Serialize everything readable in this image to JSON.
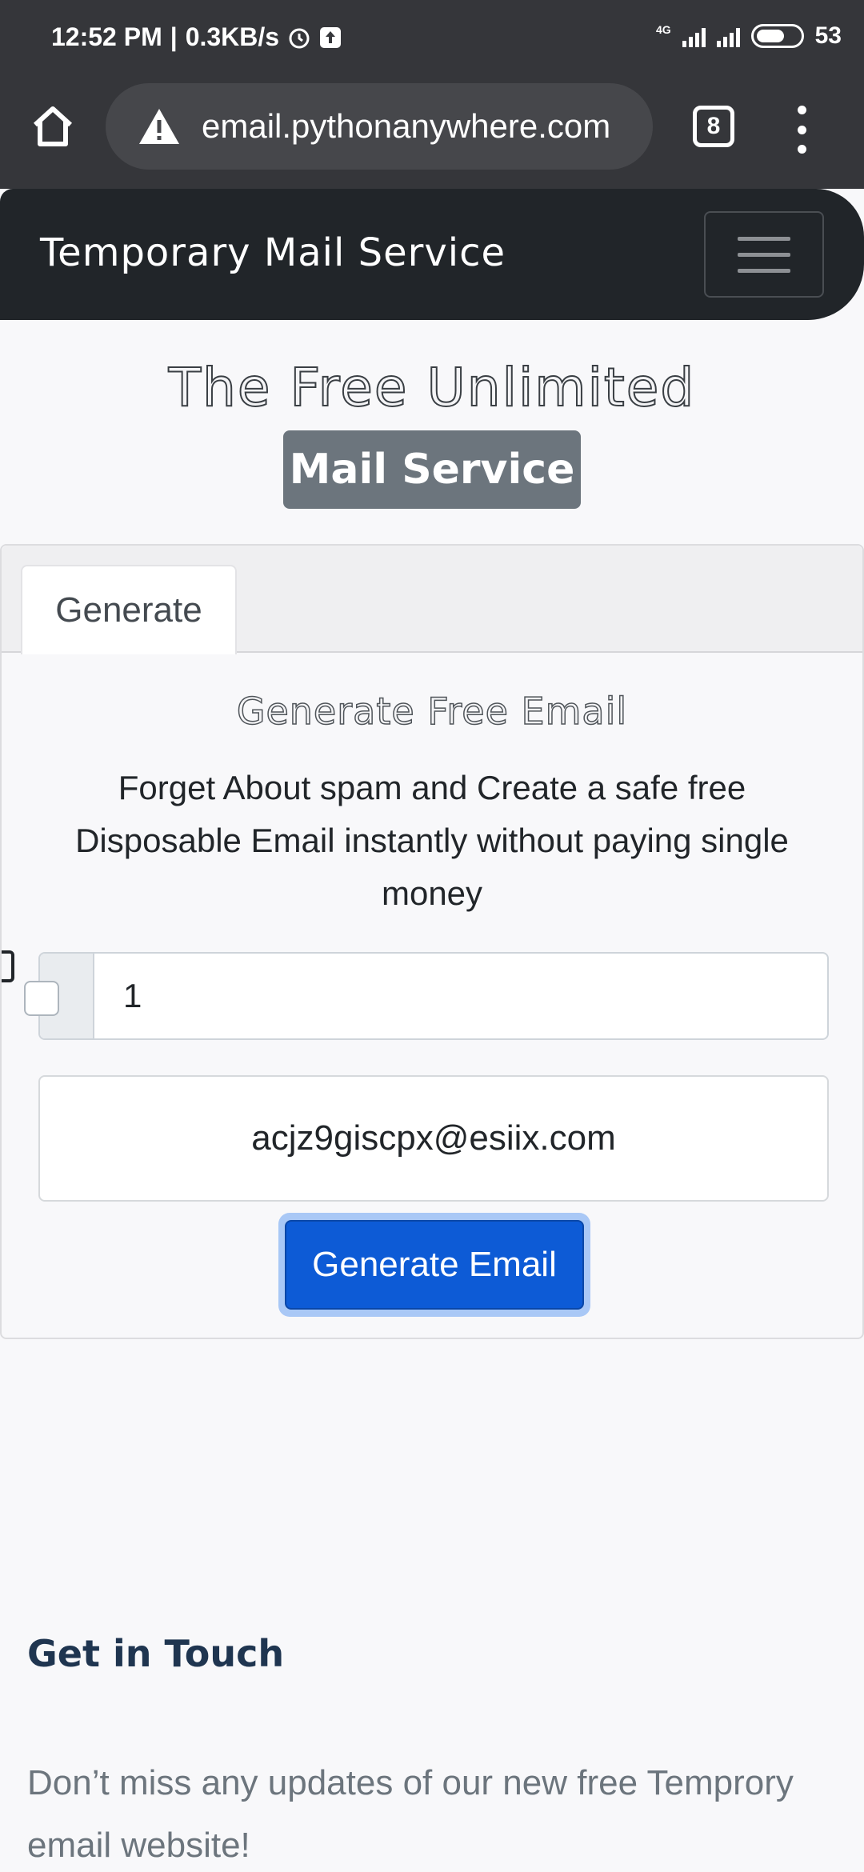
{
  "status_bar": {
    "time": "12:52 PM",
    "speed": "0.3KB/s",
    "network": "4G",
    "battery": "53"
  },
  "browser": {
    "url": "email.pythonanywhere.com",
    "tab_count": "8"
  },
  "navbar": {
    "brand": "Temporary Mail Service"
  },
  "hero": {
    "title": "The Free Unlimited",
    "badge": "Mail Service"
  },
  "card": {
    "tab_label": "Generate",
    "title": "Generate Free Email",
    "description": "Forget About spam and Create a safe free Disposable Email instantly without paying single money",
    "count_value": "1",
    "generated_email": "acjz9giscpx@esiix.com",
    "button_label": "Generate Email"
  },
  "footer": {
    "heading": "Get in Touch",
    "text": "Don’t miss any updates of our new free Temprory email website!"
  },
  "colors": {
    "primary_button": "#0d5bd6",
    "navbar": "#212529",
    "badge": "#6c757d"
  }
}
